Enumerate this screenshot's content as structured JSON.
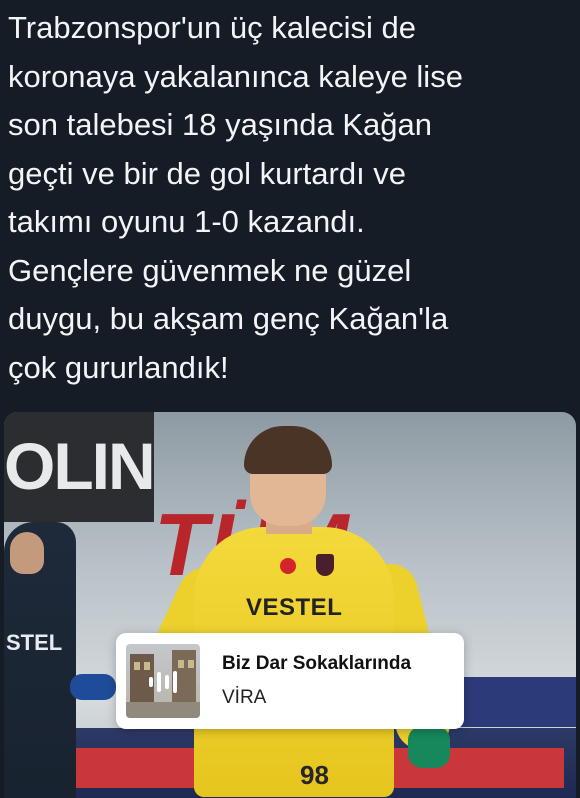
{
  "post": {
    "lines": [
      "Trabzonspor'un üç kalecisi de",
      "koronaya yakalanınca kaleye lise",
      "son talebesi 18 yaşında Kağan",
      "geçti ve bir de gol kurtardı ve",
      "takımı oyunu 1-0 kazandı.",
      "Gençlere güvenmek ne güzel",
      "duygu, bu akşam genç Kağan'la",
      "çok gururlandık!"
    ]
  },
  "photo": {
    "banner_text": "OLIN",
    "ad_text": "TÜM",
    "teammate_label": "STEL",
    "sponsor": "VESTEL",
    "shirt_number": "98"
  },
  "music": {
    "title": "Biz Dar Sokaklarında",
    "artist": "VİRA",
    "icon": "sound-wave-icon"
  },
  "colors": {
    "background": "#161c25",
    "text": "#f2f4f6",
    "kit_yellow": "#f3d93a"
  }
}
